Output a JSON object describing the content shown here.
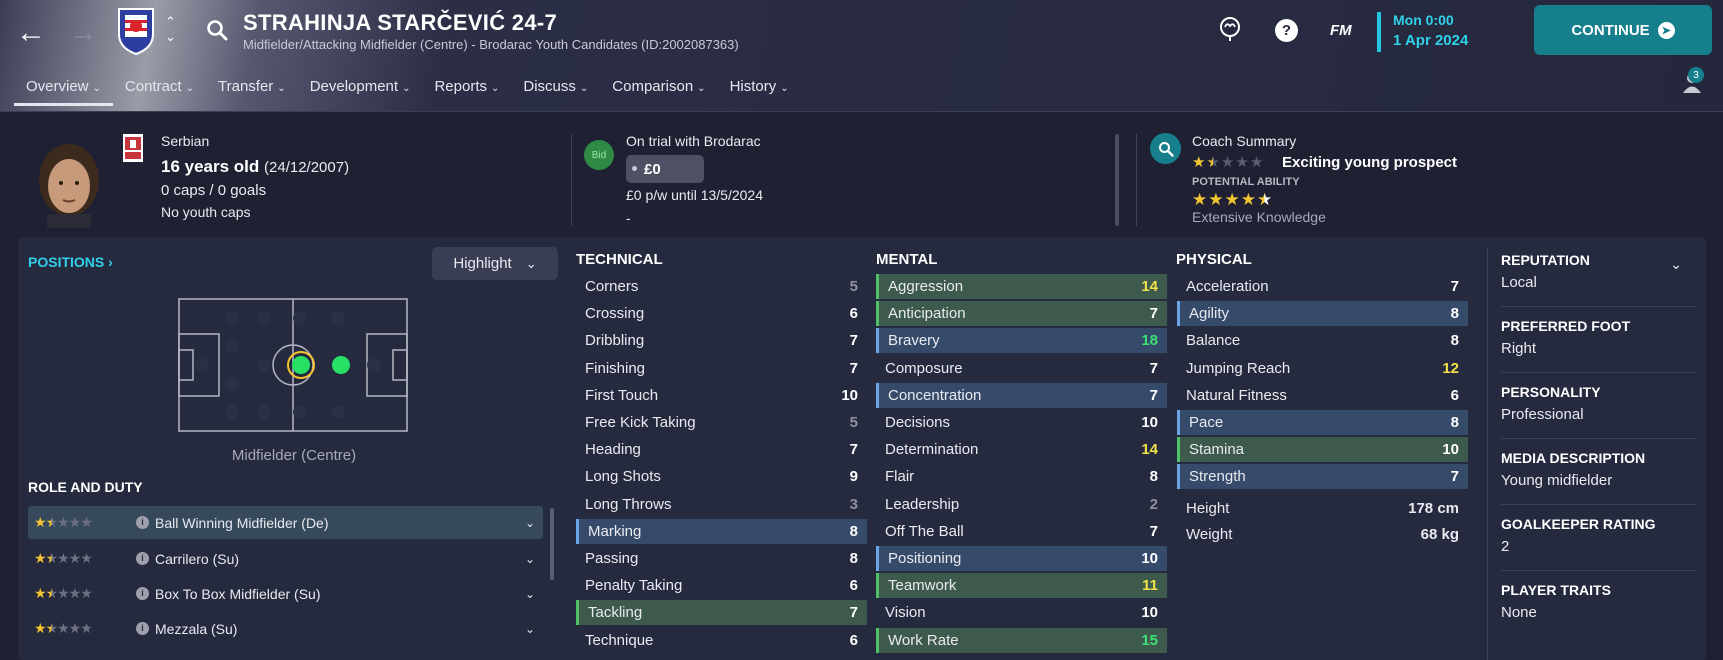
{
  "header": {
    "player_name": "STRAHINJA STARČEVIĆ 24-7",
    "subtitle": "Midfielder/Attacking Midfielder (Centre) - Brodarac Youth Candidates (ID:2002087363)",
    "fm_label": "FM",
    "time": "Mon 0:00",
    "date": "1 Apr 2024",
    "continue_label": "CONTINUE",
    "notification_count": "3",
    "accent_color": "#25c6e0",
    "continue_color": "#157f8c"
  },
  "tabs": [
    {
      "label": "Overview"
    },
    {
      "label": "Contract"
    },
    {
      "label": "Transfer"
    },
    {
      "label": "Development"
    },
    {
      "label": "Reports"
    },
    {
      "label": "Discuss"
    },
    {
      "label": "Comparison"
    },
    {
      "label": "History"
    }
  ],
  "profile": {
    "nationality": "Serbian",
    "age": "16 years old",
    "dob": "(24/12/2007)",
    "caps": "0 caps / 0 goals",
    "youth_caps": "No youth caps"
  },
  "contract": {
    "bid_label": "Bid",
    "status": "On trial with Brodarac",
    "value": "£0",
    "wage": "£0 p/w until 13/5/2024",
    "extra": "-"
  },
  "coach": {
    "title": "Coach Summary",
    "current_ability_stars": 1.5,
    "summary": "Exciting young prospect",
    "potential_label": "POTENTIAL ABILITY",
    "potential_stars": 4.5,
    "knowledge": "Extensive Knowledge"
  },
  "positions": {
    "title": "POSITIONS",
    "highlight_label": "Highlight",
    "position_label": "Midfielder (Centre)"
  },
  "role_duty": {
    "title": "ROLE AND DUTY",
    "roles": [
      {
        "label": "Ball Winning Midfielder (De)",
        "stars": 1.5
      },
      {
        "label": "Carrilero (Su)",
        "stars": 1.5
      },
      {
        "label": "Box To Box Midfielder (Su)",
        "stars": 1.5
      },
      {
        "label": "Mezzala (Su)",
        "stars": 1.5
      }
    ]
  },
  "technical": {
    "title": "TECHNICAL",
    "attrs": [
      {
        "name": "Corners",
        "value": "5"
      },
      {
        "name": "Crossing",
        "value": "6"
      },
      {
        "name": "Dribbling",
        "value": "7"
      },
      {
        "name": "Finishing",
        "value": "7"
      },
      {
        "name": "First Touch",
        "value": "10"
      },
      {
        "name": "Free Kick Taking",
        "value": "5"
      },
      {
        "name": "Heading",
        "value": "7"
      },
      {
        "name": "Long Shots",
        "value": "9"
      },
      {
        "name": "Long Throws",
        "value": "3"
      },
      {
        "name": "Marking",
        "value": "8"
      },
      {
        "name": "Passing",
        "value": "8"
      },
      {
        "name": "Penalty Taking",
        "value": "6"
      },
      {
        "name": "Tackling",
        "value": "7"
      },
      {
        "name": "Technique",
        "value": "6"
      }
    ]
  },
  "mental": {
    "title": "MENTAL",
    "attrs": [
      {
        "name": "Aggression",
        "value": "14"
      },
      {
        "name": "Anticipation",
        "value": "7"
      },
      {
        "name": "Bravery",
        "value": "18"
      },
      {
        "name": "Composure",
        "value": "7"
      },
      {
        "name": "Concentration",
        "value": "7"
      },
      {
        "name": "Decisions",
        "value": "10"
      },
      {
        "name": "Determination",
        "value": "14"
      },
      {
        "name": "Flair",
        "value": "8"
      },
      {
        "name": "Leadership",
        "value": "2"
      },
      {
        "name": "Off The Ball",
        "value": "7"
      },
      {
        "name": "Positioning",
        "value": "10"
      },
      {
        "name": "Teamwork",
        "value": "11"
      },
      {
        "name": "Vision",
        "value": "10"
      },
      {
        "name": "Work Rate",
        "value": "15"
      }
    ]
  },
  "physical": {
    "title": "PHYSICAL",
    "attrs": [
      {
        "name": "Acceleration",
        "value": "7"
      },
      {
        "name": "Agility",
        "value": "8"
      },
      {
        "name": "Balance",
        "value": "8"
      },
      {
        "name": "Jumping Reach",
        "value": "12"
      },
      {
        "name": "Natural Fitness",
        "value": "6"
      },
      {
        "name": "Pace",
        "value": "8"
      },
      {
        "name": "Stamina",
        "value": "10"
      },
      {
        "name": "Strength",
        "value": "7"
      }
    ],
    "height_label": "Height",
    "height": "178 cm",
    "weight_label": "Weight",
    "weight": "68 kg"
  },
  "info": {
    "reputation_label": "REPUTATION",
    "reputation": "Local",
    "foot_label": "PREFERRED FOOT",
    "foot": "Right",
    "personality_label": "PERSONALITY",
    "personality": "Professional",
    "media_label": "MEDIA DESCRIPTION",
    "media": "Young midfielder",
    "gk_label": "GOALKEEPER RATING",
    "gk": "2",
    "traits_label": "PLAYER TRAITS",
    "traits": "None"
  }
}
